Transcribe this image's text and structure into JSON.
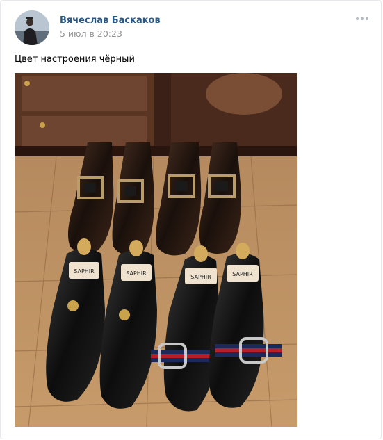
{
  "post": {
    "author_name": "Вячеслав Баскаков",
    "date": "5 июл в 20:23",
    "text": "Цвет настроения чёрный",
    "more_icon": "more-horizontal-icon",
    "photo_description_icon": "photo"
  },
  "shoe_tree_brand": "SAPHIR",
  "colors": {
    "link": "#2a5885",
    "muted": "#939393",
    "border": "#e7e8ec"
  }
}
